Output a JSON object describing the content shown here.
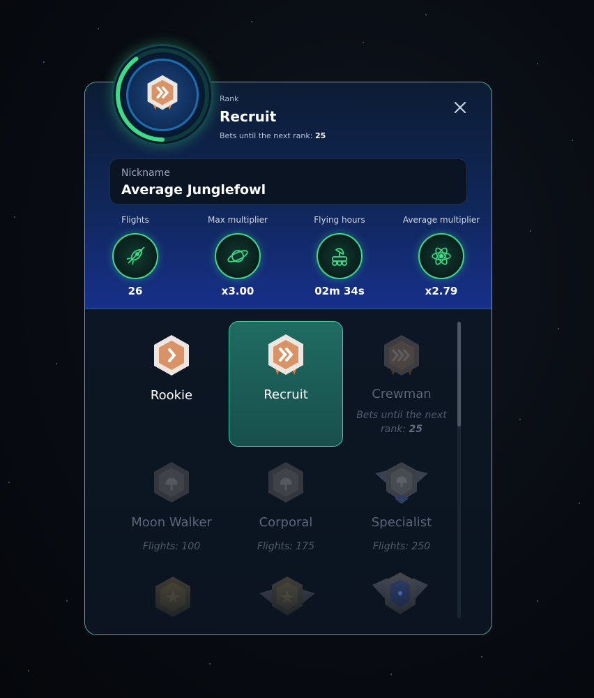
{
  "header": {
    "rank_label": "Rank",
    "rank_title": "Recruit",
    "bets_text": "Bets until the next rank: ",
    "bets_value": "25",
    "progress": 0.4
  },
  "nickname": {
    "label": "Nickname",
    "value": "Average Junglefowl"
  },
  "stats": [
    {
      "label": "Flights",
      "value": "26",
      "icon": "rocket-icon"
    },
    {
      "label": "Max multiplier",
      "value": "x3.00",
      "icon": "planet-icon"
    },
    {
      "label": "Flying hours",
      "value": "02m 34s",
      "icon": "rover-icon"
    },
    {
      "label": "Average multiplier",
      "value": "x2.79",
      "icon": "atom-icon"
    }
  ],
  "ranks": [
    {
      "name": "Rookie",
      "note": "",
      "state": "achieved"
    },
    {
      "name": "Recruit",
      "note": "",
      "state": "current"
    },
    {
      "name": "Crewman",
      "note_prefix": "Bets until the next rank: ",
      "note_value": "25",
      "state": "next"
    },
    {
      "name": "Moon Walker",
      "note": "Flights: 100",
      "state": "locked"
    },
    {
      "name": "Corporal",
      "note": "Flights: 175",
      "state": "locked"
    },
    {
      "name": "Specialist",
      "note": "Flights: 250",
      "state": "locked"
    }
  ],
  "colors": {
    "accent": "#3ddc84",
    "panel_border": "#3fbf9f",
    "badge_orange": "#d99366",
    "active_card": "#1f6b62"
  }
}
